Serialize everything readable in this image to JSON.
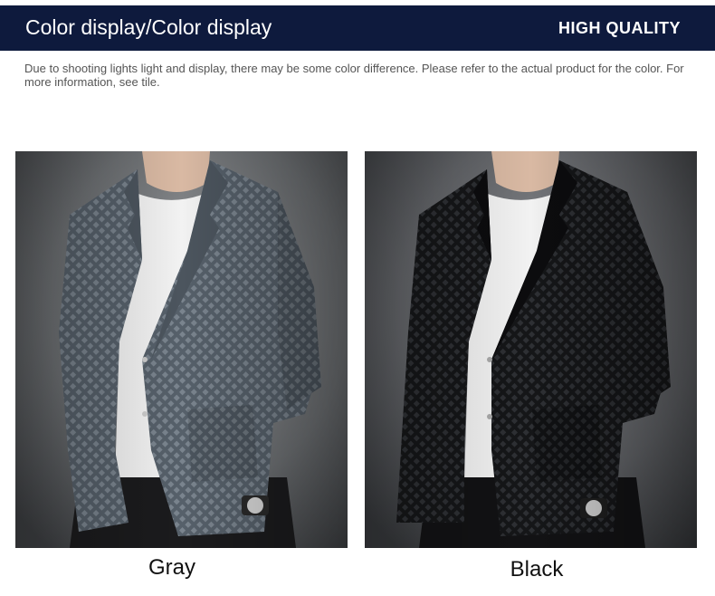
{
  "header": {
    "title": "Color display/Color display",
    "badge": "HIGH QUALITY",
    "background": "#0e1a3d"
  },
  "notice": {
    "text": "Due to shooting lights light and display, there may be some color difference. Please refer to the actual product for the color. For more information, see tile."
  },
  "products": [
    {
      "label": "Gray",
      "jacket_color": "#5c6670",
      "icon": "gray-blazer-photo"
    },
    {
      "label": "Black",
      "jacket_color": "#1c1d20",
      "icon": "black-blazer-photo"
    }
  ]
}
